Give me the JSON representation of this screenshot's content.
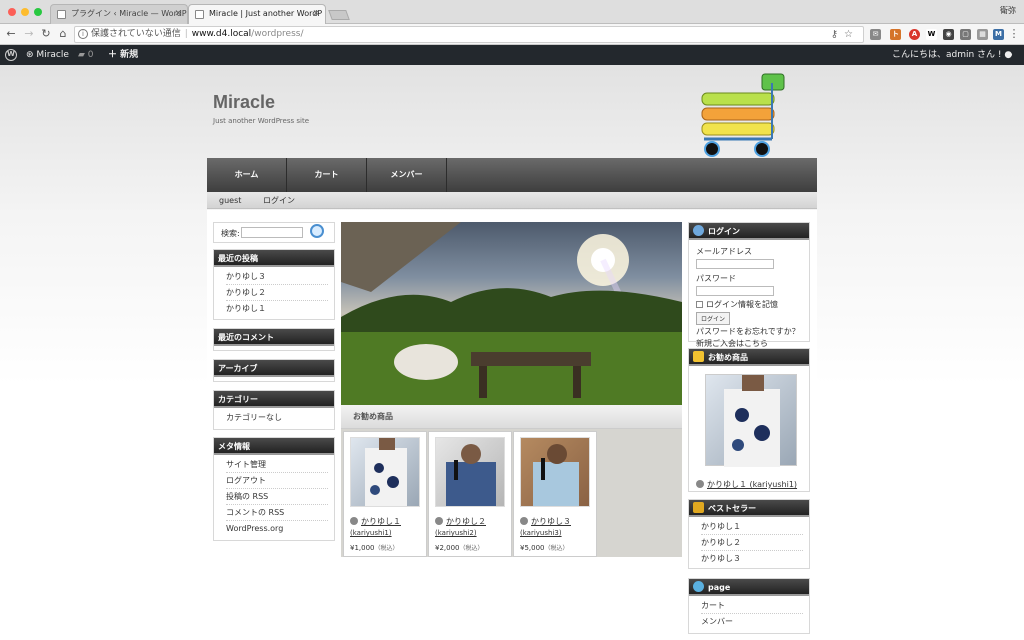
{
  "browser": {
    "tabs": [
      {
        "label": "プラグイン ‹ Miracle — WordP",
        "active": false
      },
      {
        "label": "Miracle | Just another WordP",
        "active": true
      }
    ],
    "user": "衛弥",
    "address": {
      "security": "保護されていない通信",
      "domain": "www.d4.local",
      "path": "/wordpress/"
    }
  },
  "adminbar": {
    "site_name": "Miracle",
    "comments_count": "0",
    "new_label": "新規",
    "greeting": "こんにちは、admin さん !"
  },
  "site": {
    "title": "Miracle",
    "description": "Just another WordPress site",
    "nav": [
      "ホーム",
      "カート",
      "メンバー"
    ],
    "subnav": [
      "guest",
      "ログイン"
    ]
  },
  "left_sidebar": {
    "search_label": "検索:",
    "recent_posts": {
      "title": "最近の投稿",
      "items": [
        "かりゆし３",
        "かりゆし２",
        "かりゆし１"
      ]
    },
    "recent_comments": {
      "title": "最近のコメント"
    },
    "archives": {
      "title": "アーカイブ"
    },
    "categories": {
      "title": "カテゴリー",
      "items": [
        "カテゴリーなし"
      ]
    },
    "meta": {
      "title": "メタ情報",
      "items": [
        "サイト管理",
        "ログアウト",
        "投稿の RSS",
        "コメントの RSS",
        "WordPress.org"
      ]
    }
  },
  "main": {
    "recommended_title": "お勧め商品",
    "products": [
      {
        "name": "かりゆし１",
        "code": "(kariyushi1)",
        "price": "¥1,000",
        "tax": "（税込）"
      },
      {
        "name": "かりゆし２",
        "code": "(kariyushi2)",
        "price": "¥2,000",
        "tax": "（税込）"
      },
      {
        "name": "かりゆし３",
        "code": "(kariyushi3)",
        "price": "¥5,000",
        "tax": "（税込）"
      }
    ]
  },
  "right_sidebar": {
    "login": {
      "title": "ログイン",
      "email_label": "メールアドレス",
      "password_label": "パスワード",
      "remember_label": "ログイン情報を記憶",
      "login_button": "ログイン",
      "forgot_link": "パスワードをお忘れですか？",
      "register_link": "新規ご入会はこちら"
    },
    "featured": {
      "title": "お勧め商品",
      "item": "かりゆし１ (kariyushi1)"
    },
    "bestseller": {
      "title": "ベストセラー",
      "items": [
        "かりゆし１",
        "かりゆし２",
        "かりゆし３"
      ]
    },
    "page": {
      "title": "page",
      "items": [
        "カート",
        "メンバー"
      ]
    }
  }
}
